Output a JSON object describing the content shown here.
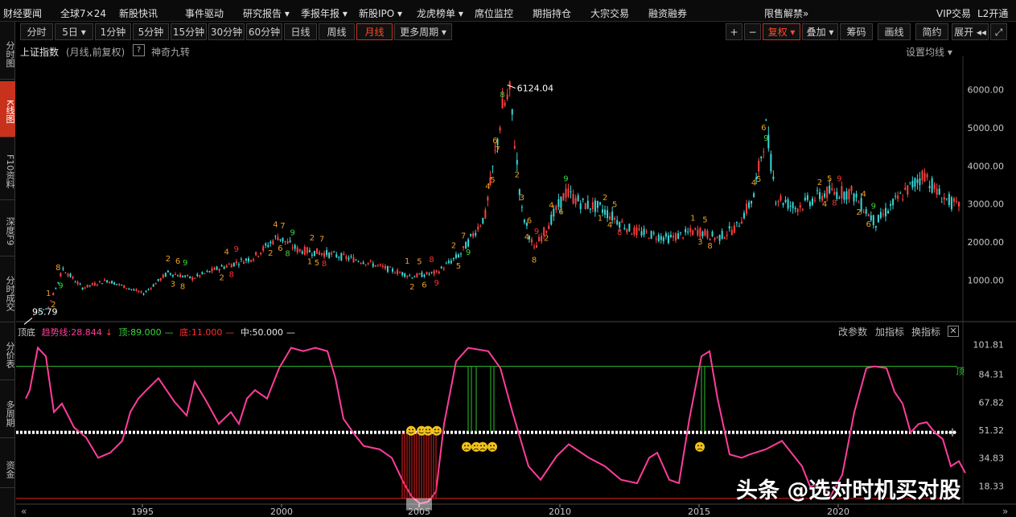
{
  "top_menu": {
    "items": [
      "财经要闻",
      "全球7×24",
      "新股快讯",
      "事件驱动",
      "研究报告 ▾",
      "季报年报 ▾",
      "新股IPO ▾",
      "龙虎榜单 ▾",
      "席位监控",
      "期指持仓",
      "大宗交易",
      "融资融券",
      "限售解禁»"
    ],
    "vip": "VIP交易",
    "l2": "L2开通"
  },
  "sidebar": {
    "items": [
      "分时图",
      "K线图",
      "F10资料",
      "深度F9",
      "分时成交",
      "分价表",
      "多周期",
      "资金"
    ]
  },
  "periods": {
    "items": [
      "分时",
      "5日 ▾",
      "1分钟",
      "5分钟",
      "15分钟",
      "30分钟",
      "60分钟",
      "日线",
      "周线",
      "月线",
      "更多周期 ▾"
    ],
    "active": "月线"
  },
  "tools": {
    "plus": "+",
    "minus": "−",
    "fuquan": "复权 ▾",
    "overlay": "叠加 ▾",
    "chips": "筹码",
    "draw": "画线",
    "simple": "简约",
    "expand": "展开 ◂◂",
    "fullscreen": "⤢"
  },
  "chart": {
    "title": "上证指数",
    "subtitle": "(月线,前复权)",
    "help": "?",
    "indicator": "神奇九转",
    "ma_setting": "设置均线 ▾",
    "y_labels": [
      "6000.00",
      "5000.00",
      "4000.00",
      "3000.00",
      "2000.00",
      "1000.00"
    ],
    "high_label": "6124.04",
    "low_label": "95.79",
    "x_labels": [
      "1995",
      "2000",
      "2005",
      "2010",
      "2015",
      "2020"
    ]
  },
  "indicator_panel": {
    "name": "顶底",
    "trend_label": "趋势线:28.844",
    "trend_arrow": "↓",
    "top_label": "顶:89.000",
    "top_dash": "—",
    "bottom_label": "底:11.000",
    "bottom_dash": "—",
    "mid_label": "中:50.000",
    "mid_dash": "—",
    "tools": [
      "改参数",
      "加指标",
      "换指标"
    ],
    "close": "✕",
    "y_labels": [
      "101.81",
      "84.31",
      "67.82",
      "51.32",
      "34.83",
      "18.33"
    ],
    "top_marker": "顶"
  },
  "colors": {
    "up": "#ff4040",
    "down": "#36d8d8",
    "nine_orange": "#f0a020",
    "nine_green": "#39d839",
    "nine_red": "#ff3030",
    "trend_line": "#ff3d9a",
    "top_line": "#2ec02e",
    "bottom_line": "#e82020",
    "accent": "#c8321c"
  },
  "watermark": "头条 @选对时机买对股"
}
